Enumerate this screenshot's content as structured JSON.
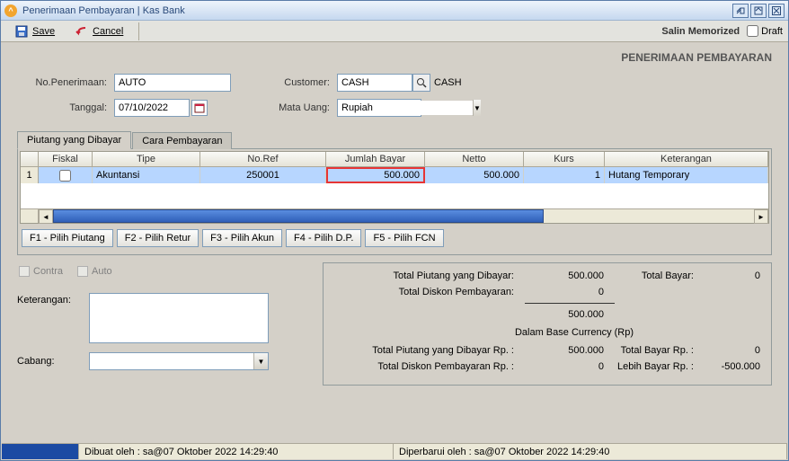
{
  "window": {
    "title": "Penerimaan Pembayaran | Kas Bank"
  },
  "toolbar": {
    "save_label": "Save",
    "cancel_label": "Cancel",
    "salin_label": "Salin Memorized",
    "draft_label": "Draft"
  },
  "header": {
    "section_title": "PENERIMAAN PEMBAYARAN"
  },
  "form": {
    "no_label": "No.Penerimaan:",
    "no_value": "AUTO",
    "tanggal_label": "Tanggal:",
    "tanggal_value": "07/10/2022",
    "customer_label": "Customer:",
    "customer_value": "CASH",
    "customer_name": "CASH",
    "mata_uang_label": "Mata Uang:",
    "mata_uang_value": "Rupiah"
  },
  "tabs": {
    "piutang": "Piutang yang Dibayar",
    "cara": "Cara Pembayaran"
  },
  "grid": {
    "cols": {
      "rownum": "",
      "fiskal": "Fiskal",
      "tipe": "Tipe",
      "noref": "No.Ref",
      "jumlah": "Jumlah Bayar",
      "netto": "Netto",
      "kurs": "Kurs",
      "ket": "Keterangan"
    },
    "rows": [
      {
        "num": "1",
        "fiskal": "",
        "tipe": "Akuntansi",
        "noref": "250001",
        "jumlah": "500.000",
        "netto": "500.000",
        "kurs": "1",
        "ket": "Hutang Temporary"
      }
    ]
  },
  "actions": {
    "f1": "F1 - Pilih Piutang",
    "f2": "F2 - Pilih Retur",
    "f3": "F3 - Pilih Akun",
    "f4": "F4 - Pilih D.P.",
    "f5": "F5 - Pilih FCN"
  },
  "checks": {
    "contra": "Contra",
    "auto": "Auto"
  },
  "keterangan_label": "Keterangan:",
  "keterangan_value": "",
  "cabang_label": "Cabang:",
  "cabang_value": "",
  "summary": {
    "total_piutang_l": "Total Piutang yang Dibayar:",
    "total_piutang_v": "500.000",
    "total_bayar_l": "Total Bayar:",
    "total_bayar_v": "0",
    "total_diskon_l": "Total Diskon Pembayaran:",
    "total_diskon_v": "0",
    "subtotal_v": "500.000",
    "base_cur": "Dalam Base Currency (Rp)",
    "total_piutang_rp_l": "Total Piutang yang Dibayar Rp. :",
    "total_piutang_rp_v": "500.000",
    "total_bayar_rp_l": "Total Bayar Rp. :",
    "total_bayar_rp_v": "0",
    "total_diskon_rp_l": "Total Diskon Pembayaran Rp. :",
    "total_diskon_rp_v": "0",
    "lebih_bayar_rp_l": "Lebih Bayar Rp. :",
    "lebih_bayar_rp_v": "-500.000"
  },
  "status": {
    "created": "Dibuat oleh : sa@07 Oktober 2022  14:29:40",
    "updated": "Diperbarui oleh : sa@07 Oktober 2022  14:29:40"
  }
}
